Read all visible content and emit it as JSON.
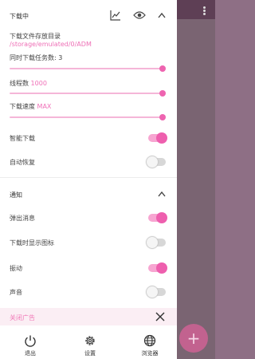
{
  "download_section": {
    "title": "下载中",
    "storage_label": "下载文件存放目录",
    "storage_path": "/storage/emulated/0/ADM",
    "concurrent_label": "同时下载任务数: 3",
    "threads_label": "线程数",
    "threads_value": "1000",
    "speed_label": "下载速度",
    "speed_value": "MAX",
    "smart_download_label": "智能下载",
    "smart_download_on": true,
    "auto_resume_label": "自动恢复",
    "auto_resume_on": false
  },
  "notify_section": {
    "title": "通知",
    "popup_label": "弹出消息",
    "popup_on": true,
    "show_icon_label": "下载时显示图标",
    "show_icon_on": false,
    "vibrate_label": "振动",
    "vibrate_on": true,
    "sound_label": "声音",
    "sound_on": false
  },
  "ad_banner": {
    "label": "关闭广告"
  },
  "bottom_nav": [
    {
      "label": "退出",
      "icon": "power-icon"
    },
    {
      "label": "设置",
      "icon": "gear-icon"
    },
    {
      "label": "浏览器",
      "icon": "globe-icon"
    }
  ],
  "fab": {
    "label": "+"
  },
  "colors": {
    "accent": "#ee5fae",
    "accent_light": "#f7a5d1",
    "scrim": "#8e6f85"
  }
}
